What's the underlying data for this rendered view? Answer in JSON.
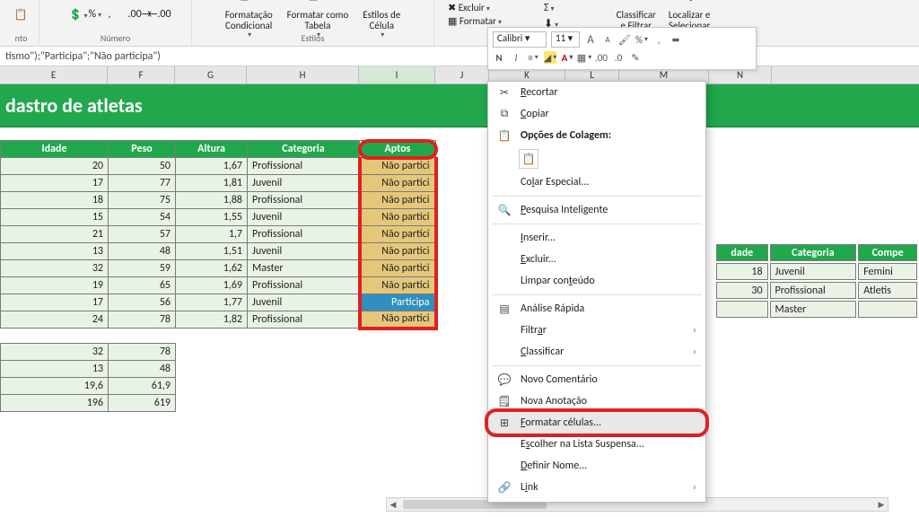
{
  "ribbon": {
    "groups": {
      "numero": "Número",
      "estilos": "Estilos",
      "nto": "nto"
    },
    "cond_fmt": "Formatação\nCondicional",
    "table_fmt": "Formatar como\nTabela",
    "cell_styles": "Estilos de\nCélula",
    "excluir": "Excluir",
    "formatar": "Formatar",
    "classificar": "Classificar\ne Filtrar",
    "localizar": "Localizar e\nSelecionar"
  },
  "formula": "tismo\");\"Participa\";\"Não participa\")",
  "cols": [
    "E",
    "F",
    "G",
    "H",
    "I",
    "J",
    "K",
    "L",
    "M",
    "N"
  ],
  "title": "dastro de atletas",
  "headers": {
    "idade": "Idade",
    "peso": "Peso",
    "altura": "Altura",
    "categoria": "Categoria",
    "aptos": "Aptos",
    "dade": "dade",
    "competi": "Compe"
  },
  "rows": [
    {
      "idade": "20",
      "peso": "50",
      "altura": "1,67",
      "cat": "Profissional",
      "apto": "Não partici"
    },
    {
      "idade": "17",
      "peso": "77",
      "altura": "1,81",
      "cat": "Juvenil",
      "apto": "Não partici"
    },
    {
      "idade": "18",
      "peso": "75",
      "altura": "1,88",
      "cat": "Profissional",
      "apto": "Não partici"
    },
    {
      "idade": "15",
      "peso": "54",
      "altura": "1,55",
      "cat": "Juvenil",
      "apto": "Não partici"
    },
    {
      "idade": "21",
      "peso": "57",
      "altura": "1,7",
      "cat": "Profissional",
      "apto": "Não partici"
    },
    {
      "idade": "13",
      "peso": "48",
      "altura": "1,51",
      "cat": "Juvenil",
      "apto": "Não partici"
    },
    {
      "idade": "32",
      "peso": "59",
      "altura": "1,62",
      "cat": "Master",
      "apto": "Não partici"
    },
    {
      "idade": "19",
      "peso": "65",
      "altura": "1,69",
      "cat": "Profissional",
      "apto": "Não partici"
    },
    {
      "idade": "17",
      "peso": "56",
      "altura": "1,77",
      "cat": "Juvenil",
      "apto": "Participa",
      "p": true
    },
    {
      "idade": "24",
      "peso": "78",
      "altura": "1,82",
      "cat": "Profissional",
      "apto": "Não partici"
    }
  ],
  "stats": [
    [
      "32",
      "78"
    ],
    [
      "13",
      "48"
    ],
    [
      "19,6",
      "61,9"
    ],
    [
      "196",
      "619"
    ]
  ],
  "side": [
    {
      "dade": "18",
      "cat": "Juvenil",
      "comp": "Femini"
    },
    {
      "dade": "30",
      "cat": "Profissional",
      "comp": "Atletis"
    },
    {
      "dade": "",
      "cat": "Master",
      "comp": ""
    }
  ],
  "mini": {
    "font": "Calibri",
    "size": "11"
  },
  "ctx": {
    "recortar": "Recortar",
    "copiar": "Copiar",
    "colagem": "Opções de Colagem:",
    "colar_esp": "Colar Especial...",
    "pesquisa": "Pesquisa Inteligente",
    "inserir": "Inserir...",
    "excluir": "Excluir...",
    "limpar": "Limpar conteúdo",
    "analise": "Análise Rápida",
    "filtrar": "Filtrar",
    "classif": "Classificar",
    "novocom": "Novo Comentário",
    "novaanot": "Nova Anotação",
    "formatar": "Formatar células...",
    "escolher": "Escolher na Lista Suspensa...",
    "definir": "Definir Nome...",
    "link": "Link"
  },
  "colw": {
    "E": 120,
    "F": 75,
    "G": 80,
    "H": 125,
    "I": 85,
    "J": 60,
    "K": 85,
    "L": 60,
    "M": 100,
    "N": 70
  }
}
